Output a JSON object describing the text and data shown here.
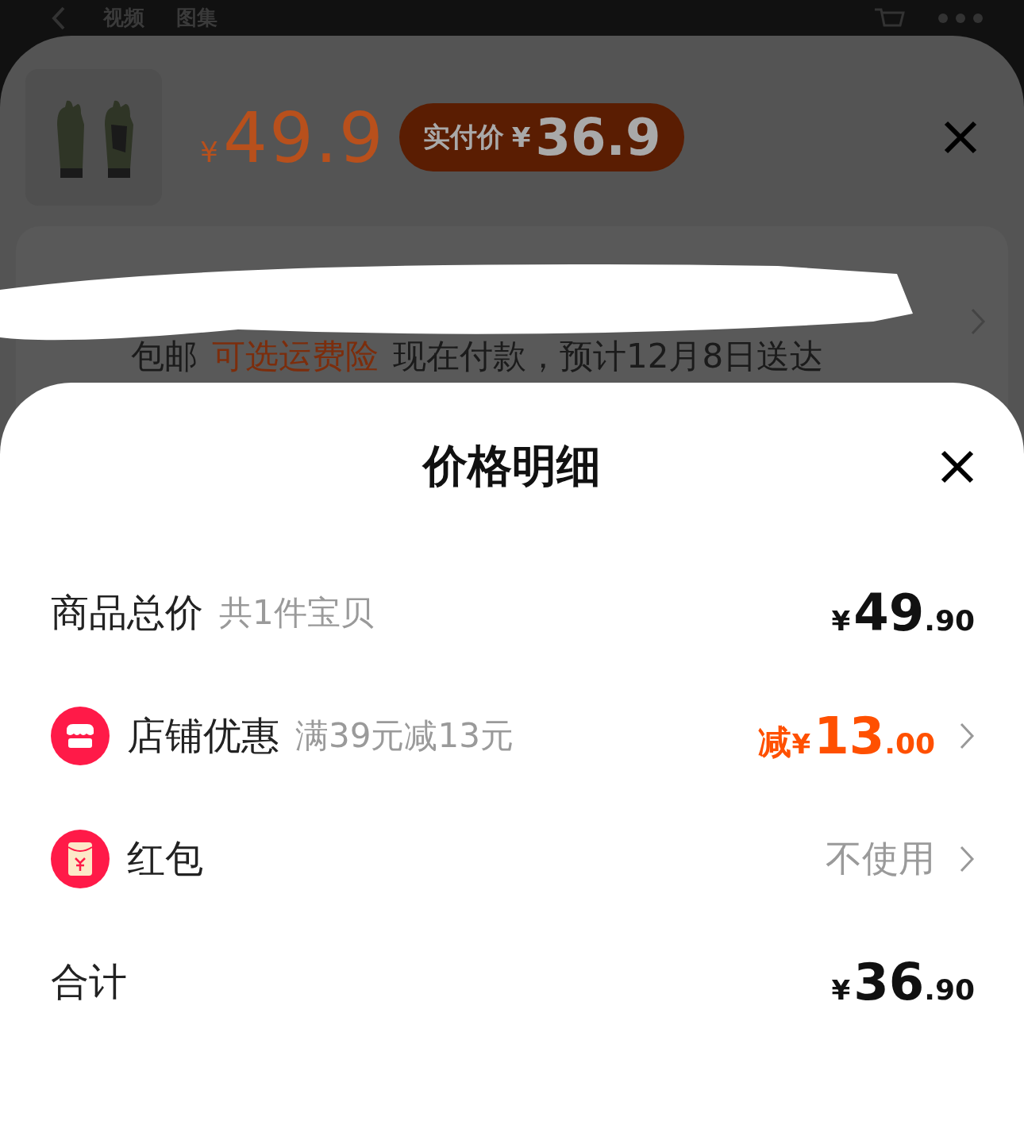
{
  "top_nav": {
    "tabs": [
      {
        "label": "视频"
      },
      {
        "label": "图集"
      }
    ]
  },
  "product_sheet": {
    "price": {
      "currency": "¥",
      "amount": "49.9"
    },
    "paid_badge": {
      "label": "实付价",
      "currency": "¥",
      "amount": "36.9"
    },
    "delivery": [
      {
        "kind": "plain",
        "text": "包邮"
      },
      {
        "kind": "link",
        "text": "可选运费险"
      },
      {
        "kind": "plain",
        "text": "现在付款，预计12月8日送达"
      }
    ]
  },
  "price_detail": {
    "title": "价格明细",
    "rows": [
      {
        "kind": "amount",
        "label": "商品总价",
        "note": "共1件宝贝",
        "currency": "¥",
        "integer": "49",
        "decimal": ".90",
        "highlight": false,
        "chevron": false
      },
      {
        "kind": "discount",
        "label": "店铺优惠",
        "note": "满39元减13元",
        "prefix": "减",
        "currency": "¥",
        "integer": "13",
        "decimal": ".00",
        "highlight": true,
        "chevron": true
      },
      {
        "kind": "packet",
        "label": "红包",
        "value": "不使用",
        "chevron": true
      },
      {
        "kind": "amount",
        "label": "合计",
        "currency": "¥",
        "integer": "36",
        "decimal": ".90",
        "highlight": false,
        "chevron": false
      }
    ]
  }
}
